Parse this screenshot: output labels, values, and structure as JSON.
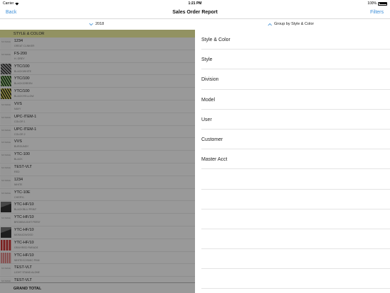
{
  "status_bar": {
    "carrier": "Carrier",
    "wifi_icon": "wifi-icon",
    "time": "1:21 PM",
    "battery": "100%",
    "battery_icon": "battery-icon"
  },
  "nav": {
    "back_label": "Back",
    "title": "Sales Order Report",
    "filters_label": "Filters"
  },
  "segments": {
    "year": "2018",
    "group": "Group by Style & Color"
  },
  "report": {
    "section_header": "STYLE & COLOR",
    "no_image_label": "NO IMAGE",
    "rows": [
      {
        "code": "1234",
        "desc": "GREAT CLINKER"
      },
      {
        "code": "FS-200",
        "desc": "H. GREY"
      },
      {
        "code": "YTC/100",
        "desc": "BLACK/WHITE"
      },
      {
        "code": "YTC/100",
        "desc": "BLACK/GREEN"
      },
      {
        "code": "YTC/100",
        "desc": "BLACK/YELLOW"
      },
      {
        "code": "VVS",
        "desc": "NAVY"
      },
      {
        "code": "UPC-ITEM-1",
        "desc": "COLOR 1"
      },
      {
        "code": "UPC-ITEM-1",
        "desc": "COLOR 2"
      },
      {
        "code": "VVS",
        "desc": "BURGUNDY"
      },
      {
        "code": "YTC-100",
        "desc": "BLACK"
      },
      {
        "code": "TEST-VLT",
        "desc": "RED"
      },
      {
        "code": "1234",
        "desc": "WHITE"
      },
      {
        "code": "YTC-10E",
        "desc": "CHERYL"
      },
      {
        "code": "YTC-HF/10",
        "desc": "BLACK/BLU PRINT"
      },
      {
        "code": "YTC-HF/10",
        "desc": "BROWN/LIGHT PERIY"
      },
      {
        "code": "YTC-HF/10",
        "desc": "MOSAIC/WOOD"
      },
      {
        "code": "YTC-HF/10",
        "desc": "GRAY/RED PARADE"
      },
      {
        "code": "YTC-HF/10",
        "desc": "WHITE/COSMIC PINK"
      },
      {
        "code": "TEST-VLT",
        "desc": "LIGHT STAND ALONE"
      },
      {
        "code": "TEST-VLT",
        "desc": ""
      }
    ],
    "grand_total_label": "GRAND TOTAL"
  },
  "group_options": [
    "Style & Color",
    "Style",
    "Division",
    "Model",
    "User",
    "Customer",
    "Master Acct"
  ]
}
